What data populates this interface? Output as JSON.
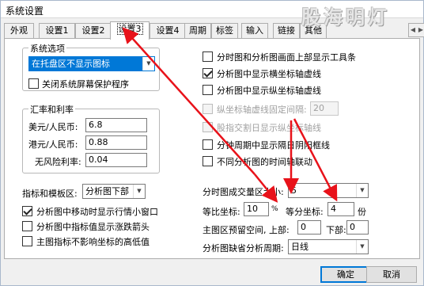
{
  "window": {
    "title": "系统设置",
    "watermark": "股海明灯"
  },
  "tabs": [
    "外观",
    "设置1",
    "设置2",
    "设置3",
    "设置4",
    "周期",
    "标签",
    "输入",
    "链接",
    "其他"
  ],
  "active_tab": "设置3",
  "system_options": {
    "legend": "系统选项",
    "tray_select": "在托盘区不显示图标",
    "close_screensaver": "关闭系统屏幕保护程序"
  },
  "exchange_rates": {
    "legend": "汇率和利率",
    "usd_label": "美元/人民币:",
    "usd_value": "6.8",
    "hkd_label": "港元/人民币:",
    "hkd_value": "0.88",
    "riskfree_label": "无风险利率:",
    "riskfree_value": "0.04"
  },
  "indicator_area": {
    "label": "指标和模板区:",
    "value": "分析图下部"
  },
  "left_checkboxes": [
    {
      "label": "分析图中移动时显示行情小窗口",
      "checked": true
    },
    {
      "label": "分析图中指标值显示涨跌箭头",
      "checked": false
    },
    {
      "label": "主图指标不影响坐标的高低值",
      "checked": false
    }
  ],
  "right_checkboxes": [
    {
      "label": "分时图和分析图画面上部显示工具条",
      "checked": false,
      "disabled": false
    },
    {
      "label": "分析图中显示横坐标轴虚线",
      "checked": true,
      "disabled": false
    },
    {
      "label": "分析图中显示纵坐标轴虚线",
      "checked": false,
      "disabled": false
    },
    {
      "label": "纵坐标轴虚线固定间隔:",
      "checked": false,
      "disabled": true
    },
    {
      "label": "股指交割日显示纵坐标轴线",
      "checked": false,
      "disabled": true
    },
    {
      "label": "分钟周期中显示隔日阴阳框线",
      "checked": false,
      "disabled": false
    },
    {
      "label": "不同分析图的时间轴联动",
      "checked": false,
      "disabled": false
    }
  ],
  "fixed_interval_value": "20",
  "volume_size": {
    "label": "分时图成交量区大小:",
    "value": "5"
  },
  "coordinates": {
    "ratio_label": "等比坐标:",
    "ratio_value": "10",
    "ratio_unit": "%",
    "equal_label": "等分坐标:",
    "equal_value": "4",
    "equal_unit": "份"
  },
  "reserve_space": {
    "label": "主图区预留空间, 上部:",
    "top_value": "0",
    "bottom_label": "下部:",
    "bottom_value": "0"
  },
  "missing_period": {
    "label": "分析图缺省分析周期:",
    "value": "日线"
  },
  "buttons": {
    "ok": "确定",
    "cancel": "取消"
  },
  "colors": {
    "accent": "#0078d7",
    "arrow": "#e8121a"
  }
}
